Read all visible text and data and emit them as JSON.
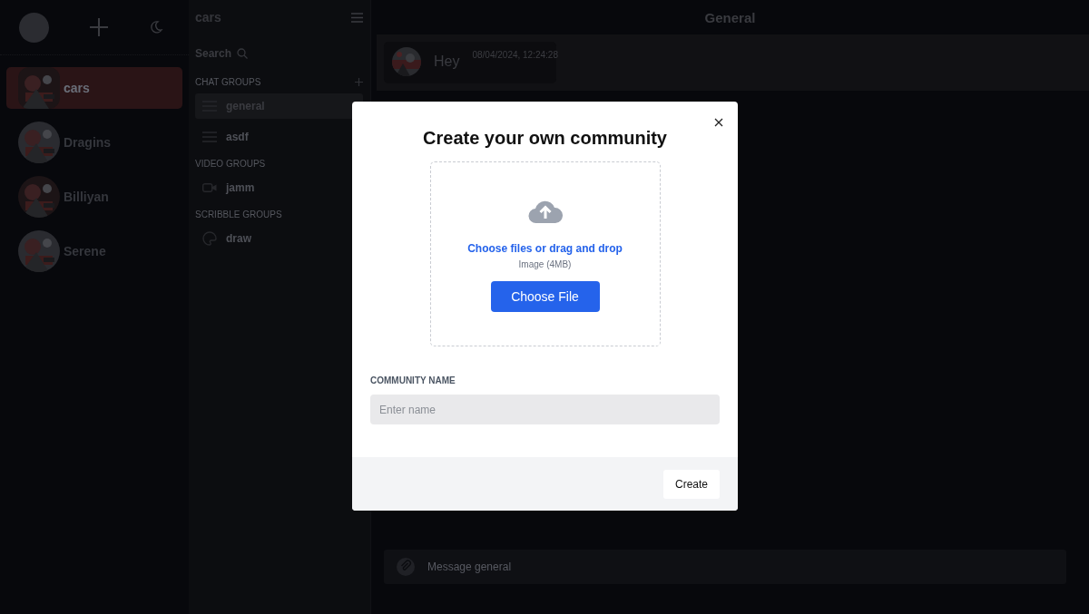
{
  "servers": [
    {
      "name": "cars",
      "selected": true
    },
    {
      "name": "Dragins",
      "selected": false
    },
    {
      "name": "Billiyan",
      "selected": false
    },
    {
      "name": "Serene",
      "selected": false
    }
  ],
  "sidebar": {
    "title": "cars",
    "search_label": "Search",
    "sections": [
      {
        "title": "CHAT GROUPS",
        "kind": "chat",
        "channels": [
          {
            "name": "general",
            "kind": "text",
            "selected": true
          },
          {
            "name": "asdf",
            "kind": "text",
            "selected": false
          }
        ]
      },
      {
        "title": "VIDEO GROUPS",
        "kind": "video",
        "channels": [
          {
            "name": "jamm",
            "kind": "video",
            "selected": false
          }
        ]
      },
      {
        "title": "SCRIBBLE GROUPS",
        "kind": "scribble",
        "channels": [
          {
            "name": "draw",
            "kind": "scribble",
            "selected": false
          }
        ]
      }
    ]
  },
  "main": {
    "title": "General",
    "messages": [
      {
        "text": "Hey",
        "time": "08/04/2024, 12:24:28"
      }
    ],
    "composer": {
      "placeholder": "Message general"
    }
  },
  "modal": {
    "title": "Create your own community",
    "upload_prompt": "Choose files or drag and drop",
    "upload_hint": "Image (4MB)",
    "choose_button": "Choose File",
    "field_label": "COMMUNITY NAME",
    "field_placeholder": "Enter name",
    "submit_button": "Create"
  }
}
